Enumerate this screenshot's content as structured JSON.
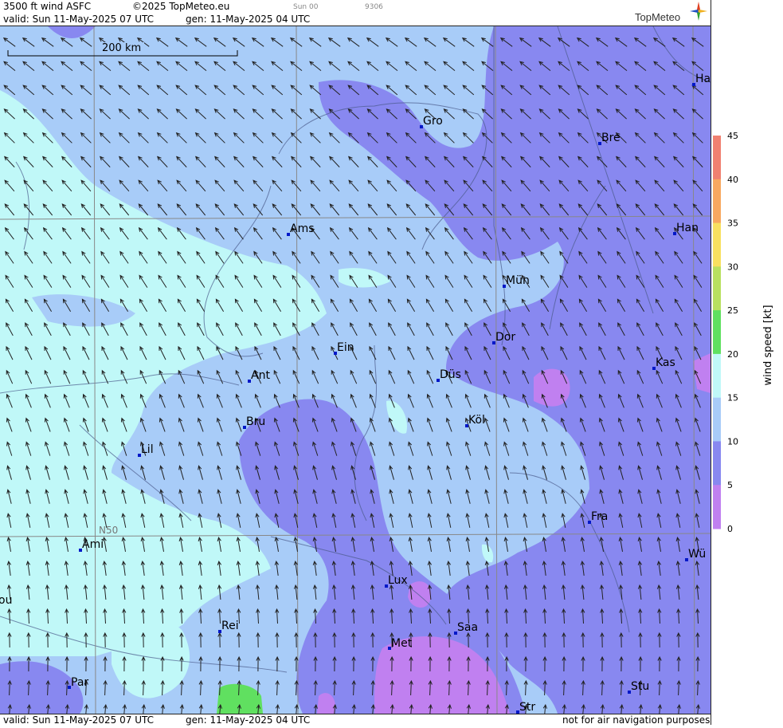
{
  "header": {
    "title": "3500 ft wind ASFC",
    "copyright": "©2025 TopMeteo.eu",
    "valid": "valid:  Sun  11-May-2025  07 UTC",
    "gen": "gen: 11-May-2025 04 UTC",
    "small1": "Sun 00",
    "small2": "9306",
    "logo": "TopMeteo"
  },
  "footer": {
    "valid": "valid:  Sun  11-May-2025  07 UTC",
    "gen": "gen: 11-May-2025 04 UTC",
    "note": "not for air navigation purposes"
  },
  "scale_label": "200 km",
  "lat_label": "N50",
  "legend": {
    "label": "wind speed [kt]",
    "ticks": [
      "45",
      "40",
      "35",
      "30",
      "25",
      "20",
      "15",
      "10",
      "5",
      "0"
    ],
    "colors": [
      "#f08070",
      "#f8a860",
      "#f8e060",
      "#b8e060",
      "#60e060",
      "#c0f8f8",
      "#a8ccf8",
      "#8888f0",
      "#c080f0"
    ]
  },
  "cities": [
    {
      "name": "Gro"
    },
    {
      "name": "Bre"
    },
    {
      "name": "Ha"
    },
    {
      "name": "Ams"
    },
    {
      "name": "Han"
    },
    {
      "name": "Mün"
    },
    {
      "name": "Dor"
    },
    {
      "name": "Ein"
    },
    {
      "name": "Kas"
    },
    {
      "name": "Ant"
    },
    {
      "name": "Düs"
    },
    {
      "name": "Köl"
    },
    {
      "name": "Bru"
    },
    {
      "name": "Lil"
    },
    {
      "name": "Fra"
    },
    {
      "name": "Ami"
    },
    {
      "name": "Wü"
    },
    {
      "name": "Lux"
    },
    {
      "name": "ou"
    },
    {
      "name": "Rei"
    },
    {
      "name": "Saa"
    },
    {
      "name": "Met"
    },
    {
      "name": "Par"
    },
    {
      "name": "Stu"
    },
    {
      "name": "Str"
    }
  ],
  "colors": {
    "calm": "#c080f0",
    "light": "#8888f0",
    "moderate": "#a8ccf8",
    "fresh": "#c0f8f8",
    "strong": "#60e060"
  }
}
